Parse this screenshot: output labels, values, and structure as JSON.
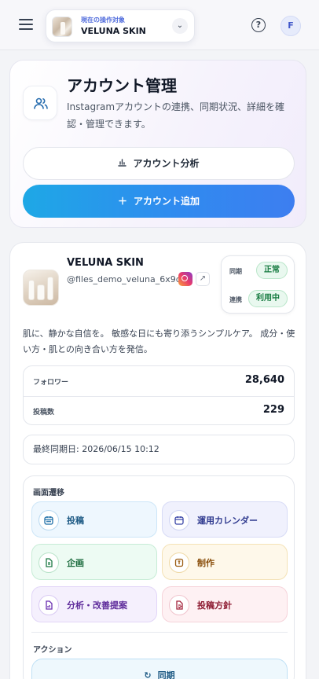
{
  "topbar": {
    "target_caption": "現在の操作対象",
    "target_name": "VELUNA SKIN",
    "avatar_letter": "F"
  },
  "hero": {
    "title": "アカウント管理",
    "description": "Instagramアカウントの連携、同期状況、詳細を確認・管理できます。",
    "analysis_button": "アカウント分析",
    "add_button": "アカウント追加"
  },
  "account": {
    "name": "VELUNA SKIN",
    "handle": "@files_demo_veluna_6x9q",
    "status": {
      "sync_label": "同期",
      "sync_value": "正常",
      "link_label": "連携",
      "link_value": "利用中"
    },
    "bio": "肌に、静かな自信を。 敏感な日にも寄り添うシンプルケア。 成分・使い方・肌との向き合い方を発信。",
    "stats": {
      "followers_label": "フォロワー",
      "followers_value": "28,640",
      "posts_label": "投稿数",
      "posts_value": "229"
    },
    "last_sync": "最終同期日: 2026/06/15 10:12"
  },
  "navigation": {
    "title": "画面遷移",
    "items": [
      {
        "label": "投稿"
      },
      {
        "label": "運用カレンダー"
      },
      {
        "label": "企画"
      },
      {
        "label": "制作"
      },
      {
        "label": "分析・改善提案"
      },
      {
        "label": "投稿方針"
      }
    ]
  },
  "actions": {
    "title": "アクション",
    "sync_button": "同期"
  },
  "colors": {
    "accent_blue": "#2f8bef",
    "success_green": "#157a3f"
  }
}
